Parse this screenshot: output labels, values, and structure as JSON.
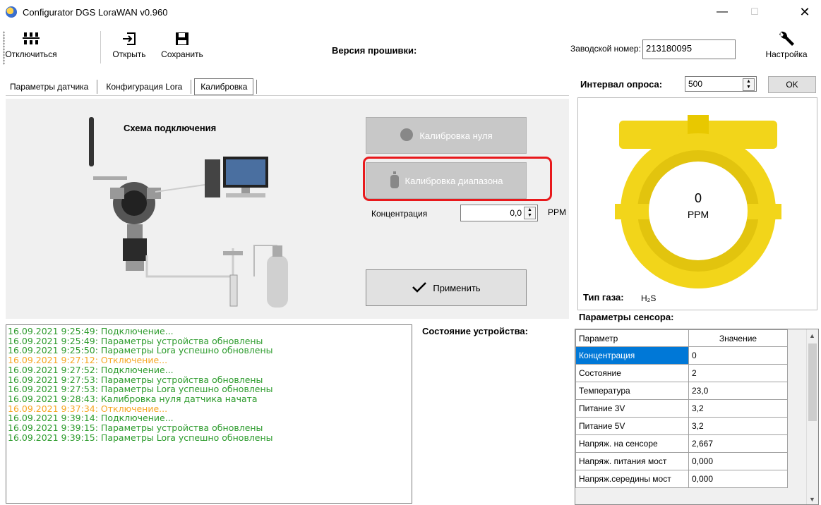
{
  "window": {
    "title": "Configurator DGS LoraWAN  v0.960"
  },
  "toolbar": {
    "disconnect_label": "Отключиться",
    "open_label": "Открыть",
    "save_label": "Сохранить",
    "firmware_label": "Версия прошивки:",
    "serial_label": "Заводской номер:",
    "serial_value": "213180095",
    "settings_label": "Настройка"
  },
  "tabs": [
    {
      "label": "Параметры датчика"
    },
    {
      "label": "Конфигурация Lora"
    },
    {
      "label": "Калибровка"
    }
  ],
  "calibration": {
    "scheme_title": "Схема подключения",
    "zero_button": "Калибровка нуля",
    "range_button": "Калибровка диапазона",
    "concentration_label": "Концентрация",
    "concentration_value": "0,0",
    "unit": "PPM",
    "apply_button": "Применить"
  },
  "poll": {
    "label": "Интервал опроса:",
    "value": "500",
    "ok_label": "OK"
  },
  "gauge": {
    "value": "0",
    "unit": "PPM",
    "gas_label": "Тип газа:",
    "gas_value": "H₂S",
    "color": "#f2d51a"
  },
  "sensor": {
    "title": "Параметры сенсора:",
    "columns": [
      "Параметр",
      "Значение"
    ],
    "rows": [
      {
        "param": "Концентрация",
        "value": "0"
      },
      {
        "param": "Состояние",
        "value": "2"
      },
      {
        "param": "Температура",
        "value": "23,0"
      },
      {
        "param": "Питание 3V",
        "value": "3,2"
      },
      {
        "param": "Питание 5V",
        "value": "3,2"
      },
      {
        "param": "Напряж. на сенсоре",
        "value": "2,667"
      },
      {
        "param": "Напряж. питания мост",
        "value": "0,000"
      },
      {
        "param": "Напряж.середины мост",
        "value": "0,000"
      }
    ]
  },
  "status_label": "Состояние устройства:",
  "log": [
    {
      "text": "16.09.2021 9:25:49: Подключение...",
      "type": "green"
    },
    {
      "text": "16.09.2021 9:25:49: Параметры устройства обновлены",
      "type": "green"
    },
    {
      "text": "16.09.2021 9:25:50: Параметры Lora успешно обновлены",
      "type": "green"
    },
    {
      "text": "16.09.2021 9:27:12: Отключение...",
      "type": "orange"
    },
    {
      "text": "16.09.2021 9:27:52: Подключение...",
      "type": "green"
    },
    {
      "text": "16.09.2021 9:27:53: Параметры устройства обновлены",
      "type": "green"
    },
    {
      "text": "16.09.2021 9:27:53: Параметры Lora успешно обновлены",
      "type": "green"
    },
    {
      "text": "16.09.2021 9:28:43: Калибровка нуля датчика начата",
      "type": "green"
    },
    {
      "text": "16.09.2021 9:37:34: Отключение...",
      "type": "orange"
    },
    {
      "text": "16.09.2021 9:39:14: Подключение...",
      "type": "green"
    },
    {
      "text": "16.09.2021 9:39:15: Параметры устройства обновлены",
      "type": "green"
    },
    {
      "text": "16.09.2021 9:39:15: Параметры Lora успешно обновлены",
      "type": "green"
    }
  ]
}
